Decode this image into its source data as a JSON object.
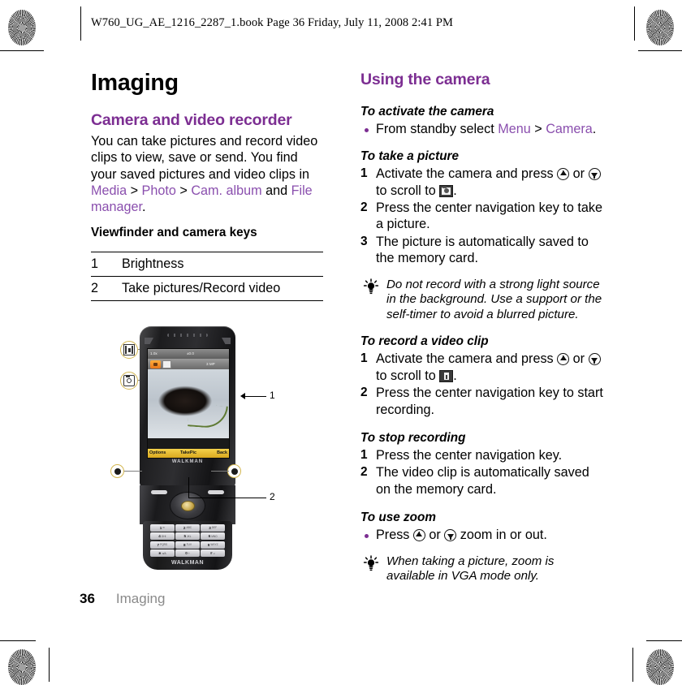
{
  "header": {
    "text": "W760_UG_AE_1216_2287_1.book  Page 36  Friday, July 11, 2008  2:41 PM"
  },
  "footer": {
    "page_number": "36",
    "chapter_name": "Imaging"
  },
  "left_column": {
    "chapter_title": "Imaging",
    "section_title": "Camera and video recorder",
    "intro": {
      "part1": "You can take pictures and record video clips to view, save or send. You find your saved pictures and video clips in ",
      "link1": "Media",
      "sep1": " > ",
      "link2": "Photo",
      "sep2": " > ",
      "link3": "Cam. album",
      "mid": " and ",
      "link4": "File manager",
      "end": "."
    },
    "subheading": "Viewfinder and camera keys",
    "key_table": {
      "rows": [
        {
          "num": "1",
          "label": "Brightness"
        },
        {
          "num": "2",
          "label": "Take pictures/Record video"
        }
      ]
    },
    "figure": {
      "screen": {
        "softkey_left": "Options",
        "softkey_center": "TakePic",
        "softkey_right": "Back",
        "status_left": "1.0x",
        "status_ev": "±0.0",
        "status_right": "3 MP",
        "brand": "WALKMAN"
      },
      "keypad": [
        {
          "digit": "1",
          "letters": "✉"
        },
        {
          "digit": "2",
          "letters": "ABC"
        },
        {
          "digit": "3",
          "letters": "DEF"
        },
        {
          "digit": "4",
          "letters": "GHI"
        },
        {
          "digit": "5",
          "letters": "JKL"
        },
        {
          "digit": "6",
          "letters": "MNO"
        },
        {
          "digit": "7",
          "letters": "PQRS"
        },
        {
          "digit": "8",
          "letters": "TUV"
        },
        {
          "digit": "9",
          "letters": "WXYZ"
        },
        {
          "digit": "∗",
          "letters": "a/A"
        },
        {
          "digit": "0",
          "letters": "+"
        },
        {
          "digit": "#",
          "letters": "↵"
        }
      ],
      "callout_labels": {
        "one": "1",
        "two": "2"
      },
      "logo": "WALKMAN"
    }
  },
  "right_column": {
    "section_title": "Using the camera",
    "tasks": [
      {
        "id": "activate-camera",
        "title": "To activate the camera",
        "type": "bullet",
        "items": [
          {
            "pre": "From standby select ",
            "link1": "Menu",
            "mid": " > ",
            "link2": "Camera",
            "post": "."
          }
        ]
      },
      {
        "id": "take-picture",
        "title": "To take a picture",
        "type": "ordered",
        "items": [
          {
            "pre": "Activate the camera and press ",
            "icon1": "nav-up-icon",
            "mid": " or ",
            "icon2": "nav-down-icon",
            "post": " to scroll to ",
            "icon3": "camera-mode-icon",
            "end": "."
          },
          {
            "text": "Press the center navigation key to take a picture."
          },
          {
            "text": "The picture is automatically saved to the memory card."
          }
        ]
      }
    ],
    "tip1": {
      "icon": "lightbulb-icon",
      "text": "Do not record with a strong light source in the background. Use a support or the self-timer to avoid a blurred picture."
    },
    "tasks2": [
      {
        "id": "record-video",
        "title": "To record a video clip",
        "type": "ordered",
        "items": [
          {
            "pre": "Activate the camera and press ",
            "icon1": "nav-up-icon",
            "mid": " or ",
            "icon2": "nav-down-icon",
            "post": " to scroll to ",
            "icon3": "video-mode-icon",
            "end": "."
          },
          {
            "text": "Press the center navigation key to start recording."
          }
        ]
      },
      {
        "id": "stop-recording",
        "title": "To stop recording",
        "type": "ordered",
        "items": [
          {
            "text": "Press the center navigation key."
          },
          {
            "text": "The video clip is automatically saved on the memory card."
          }
        ]
      },
      {
        "id": "use-zoom",
        "title": "To use zoom",
        "type": "bullet",
        "items": [
          {
            "pre": "Press ",
            "icon1": "nav-up-icon",
            "mid": " or ",
            "icon2": "nav-down-icon",
            "post": " zoom in or out."
          }
        ]
      }
    ],
    "tip2": {
      "icon": "lightbulb-icon",
      "text": "When taking a picture, zoom is available in VGA mode only."
    }
  },
  "colors": {
    "accent_purple": "#7C2E92",
    "link_purple": "#8A4FAE",
    "footer_gray": "#8A8A8A"
  }
}
